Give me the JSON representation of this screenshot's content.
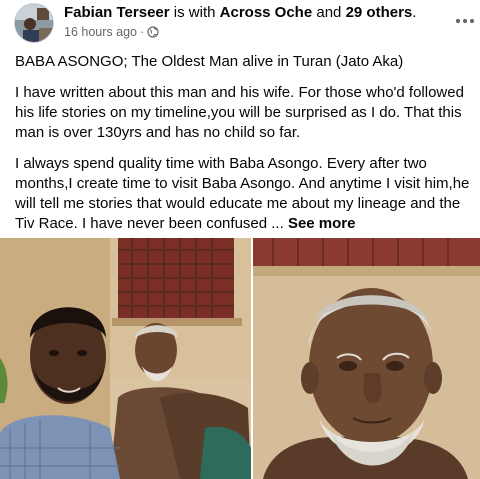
{
  "post": {
    "author": "Fabian Terseer",
    "with_text": "is with",
    "tagged": "Across Oche",
    "and_text": "and",
    "others": "29 others",
    "period": ".",
    "time": "16 hours ago",
    "dot": "·",
    "audience_icon": "globe-icon",
    "more_icon": "three-dots-icon",
    "title": "BABA ASONGO; The Oldest Man alive in Turan (Jato Aka)",
    "paragraph1": "I have written about this man and his wife. For those who'd followed his life stories on my timeline,you will be surprised as I do. That this man is over 130yrs and has no child so far.",
    "paragraph2": "I always spend quality time with Baba Asongo. Every after two months,I create time to visit Baba Asongo. And anytime I visit him,he will tell me stories that would educate me about my lineage and the Tiv Race. I have never been confused ... ",
    "see_more": "See more"
  },
  "photos": [
    "selfie-with-old-man-photo",
    "old-man-portrait-photo"
  ],
  "colors": {
    "meta_gray": "#65676b",
    "text": "#050505",
    "background": "#ffffff"
  }
}
